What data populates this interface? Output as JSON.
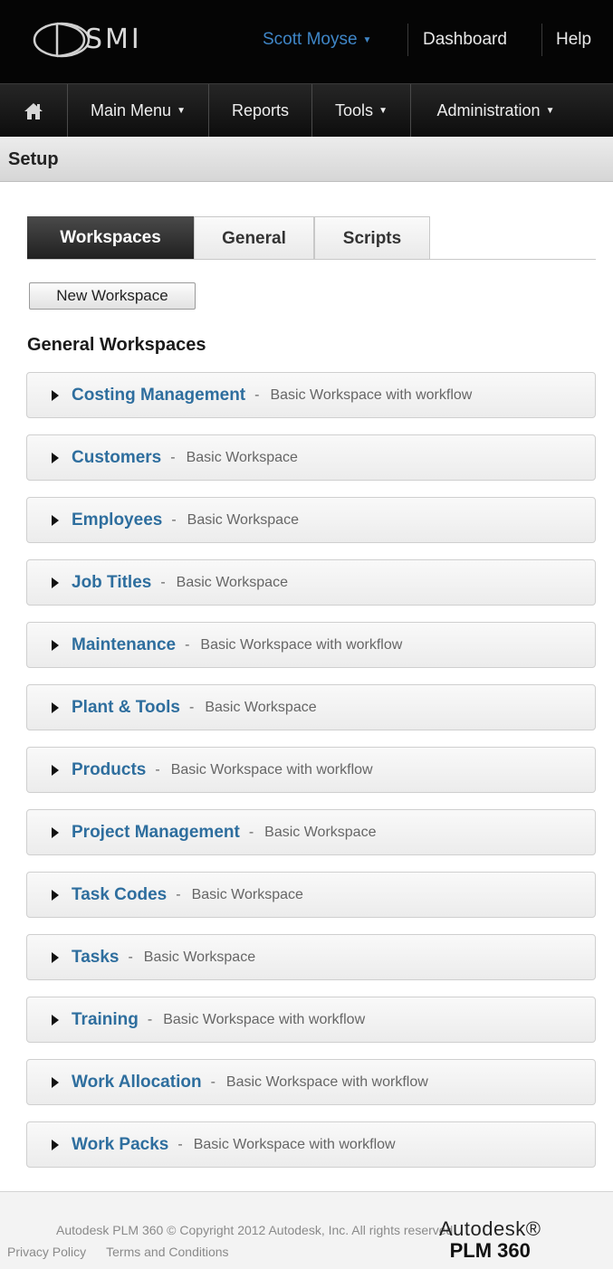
{
  "header": {
    "logo_text": "SMI",
    "user_name": "Scott Moyse",
    "dashboard_label": "Dashboard",
    "help_label": "Help"
  },
  "nav": {
    "home_icon": "home-icon",
    "items": [
      {
        "label": "Main Menu",
        "dropdown": true
      },
      {
        "label": "Reports",
        "dropdown": false
      },
      {
        "label": "Tools",
        "dropdown": true
      },
      {
        "label": "Administration",
        "dropdown": true
      }
    ]
  },
  "page": {
    "title": "Setup"
  },
  "tabs": [
    {
      "label": "Workspaces",
      "active": true
    },
    {
      "label": "General",
      "active": false
    },
    {
      "label": "Scripts",
      "active": false
    }
  ],
  "new_workspace_label": "New Workspace",
  "section_title": "General Workspaces",
  "workspaces": [
    {
      "name": "Costing Management",
      "description": "Basic Workspace with workflow"
    },
    {
      "name": "Customers",
      "description": "Basic Workspace"
    },
    {
      "name": "Employees",
      "description": "Basic Workspace"
    },
    {
      "name": "Job Titles",
      "description": "Basic Workspace"
    },
    {
      "name": "Maintenance",
      "description": "Basic Workspace with workflow"
    },
    {
      "name": "Plant & Tools",
      "description": "Basic Workspace"
    },
    {
      "name": "Products",
      "description": "Basic Workspace with workflow"
    },
    {
      "name": "Project Management",
      "description": "Basic Workspace"
    },
    {
      "name": "Task Codes",
      "description": "Basic Workspace"
    },
    {
      "name": "Tasks",
      "description": "Basic Workspace"
    },
    {
      "name": "Training",
      "description": "Basic Workspace with workflow"
    },
    {
      "name": "Work Allocation",
      "description": "Basic Workspace with workflow"
    },
    {
      "name": "Work Packs",
      "description": "Basic Workspace with workflow"
    }
  ],
  "footer": {
    "copyright": "Autodesk PLM 360 © Copyright 2012 Autodesk, Inc. All rights reserved.",
    "privacy_label": "Privacy Policy",
    "terms_label": "Terms and Conditions",
    "brand_name": "Autodesk®",
    "brand_product": "PLM 360"
  },
  "colors": {
    "link_blue": "#2e6e9e",
    "user_blue": "#3f86c7",
    "header_bg": "#050505"
  }
}
